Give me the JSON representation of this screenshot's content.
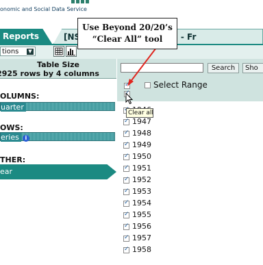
{
  "header": {
    "logo_text": "onomic and Social Data Service"
  },
  "tabs": {
    "reports": "Reports",
    "dataset": "[NS TS...ancial Statistics - Fr"
  },
  "toolbar": {
    "options_label": "tions"
  },
  "table_size": {
    "title": "Table Size",
    "value": "2925 rows by 4 columns"
  },
  "left": {
    "columns_label": "OLUMNS:",
    "columns_value": "uarter",
    "rows_label": "OWS:",
    "rows_value": "eries",
    "other_label": "THER:",
    "other_value": "ear"
  },
  "right": {
    "search_placeholder": "",
    "search_button": "Search",
    "show_button": "Sho",
    "select_range_label": "Select Range",
    "tooltip": "Clear all",
    "years": [
      "1946",
      "1947",
      "1948",
      "1949",
      "1950",
      "1951",
      "1952",
      "1953",
      "1954",
      "1955",
      "1956",
      "1957",
      "1958"
    ]
  },
  "annotation": {
    "line1": "Use Beyond 20/20’s",
    "line2": "“Clear All” tool"
  },
  "colors": {
    "accent": "#1b8a82",
    "panel": "#cfe3df",
    "annotation_arrow": "#e0261f"
  }
}
